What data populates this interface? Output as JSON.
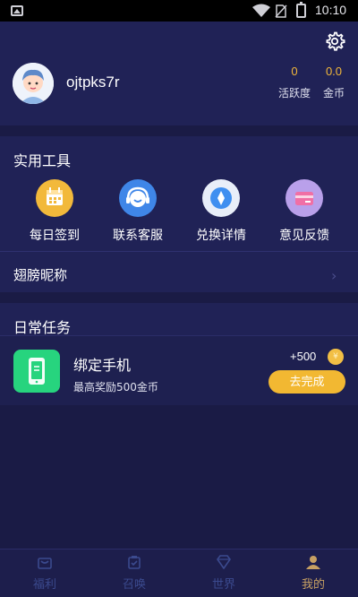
{
  "status_bar": {
    "time": "10:10"
  },
  "profile": {
    "username": "ojtpks7r",
    "stats": [
      {
        "value": "0",
        "label": "活跃度"
      },
      {
        "value": "0.0",
        "label": "金币"
      }
    ]
  },
  "tools": {
    "title": "实用工具",
    "items": [
      {
        "label": "每日签到",
        "icon": "calendar-icon"
      },
      {
        "label": "联系客服",
        "icon": "headset-icon"
      },
      {
        "label": "兑换详情",
        "icon": "diamond-icon"
      },
      {
        "label": "意见反馈",
        "icon": "card-icon"
      }
    ],
    "nickname_label": "翅膀昵称"
  },
  "daily_tasks": {
    "title": "日常任务",
    "task": {
      "title": "绑定手机",
      "subtitle": "最高奖励500金币",
      "reward": "+500",
      "button": "去完成"
    }
  },
  "bottom_nav": {
    "items": [
      {
        "label": "福利",
        "icon": "gift-icon"
      },
      {
        "label": "召唤",
        "icon": "summon-icon"
      },
      {
        "label": "世界",
        "icon": "gem-icon"
      },
      {
        "label": "我的",
        "icon": "user-icon"
      }
    ],
    "active_index": 3
  },
  "colors": {
    "background": "#1a1b45",
    "card": "#202256",
    "accent_gold": "#f2b832",
    "active_nav": "#c7a063",
    "inactive_nav": "#3b4a8e",
    "task_green": "#27d47e"
  }
}
